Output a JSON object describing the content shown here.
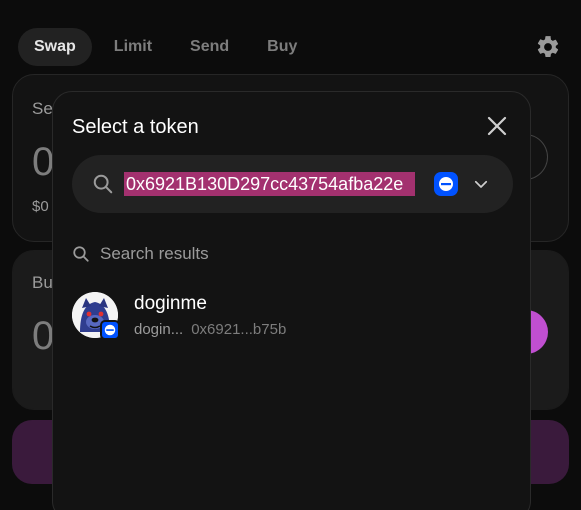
{
  "tabs": [
    {
      "label": "Swap",
      "active": true
    },
    {
      "label": "Limit",
      "active": false
    },
    {
      "label": "Send",
      "active": false
    },
    {
      "label": "Buy",
      "active": false
    }
  ],
  "background": {
    "sell_label_partial": "Se",
    "sell_amount_partial": "0",
    "sell_usd_partial": "$0",
    "buy_label_partial": "Bu",
    "buy_amount_partial": "0"
  },
  "modal": {
    "title": "Select a token",
    "search": {
      "value": "0x6921B130D297cc43754afba22e",
      "selected_chain_icon": "base-chain-icon"
    },
    "results_label": "Search results",
    "results": [
      {
        "name": "doginme",
        "symbol_truncated": "dogin...",
        "address_short": "0x6921...b75b",
        "chain_icon": "base-chain-icon"
      }
    ]
  },
  "colors": {
    "accent_pink": "#c04fd0",
    "selection_highlight": "#a3316f",
    "base_blue": "#0052ff"
  }
}
